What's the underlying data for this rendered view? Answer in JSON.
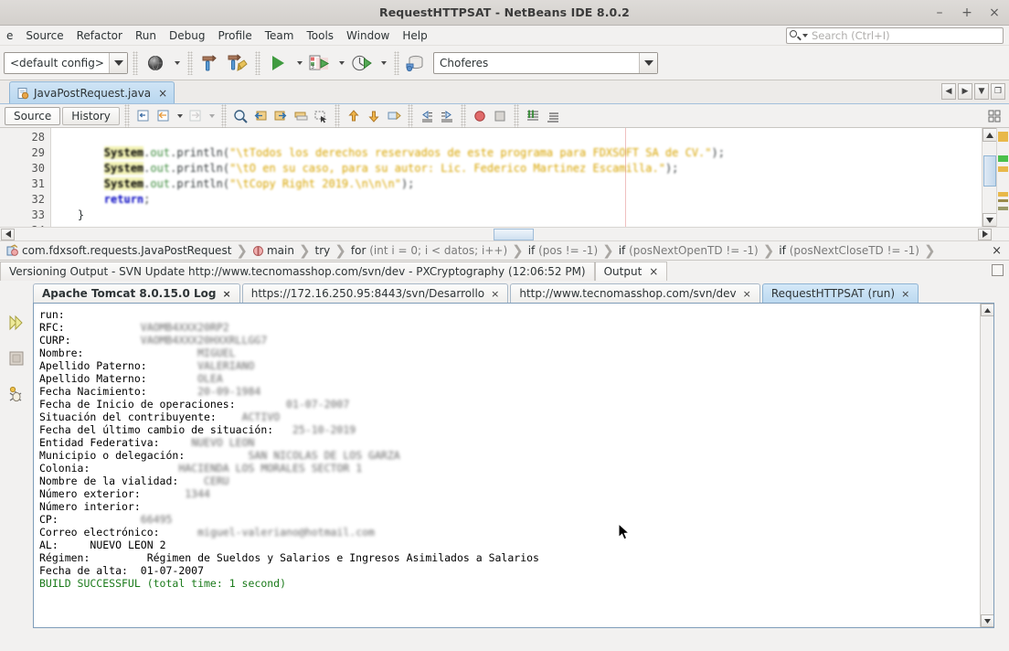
{
  "window": {
    "title": "RequestHTTPSAT - NetBeans IDE 8.0.2",
    "minimize": "–",
    "maximize": "+",
    "close": "×"
  },
  "menu": {
    "items": [
      {
        "label": "e"
      },
      {
        "label": "Source"
      },
      {
        "label": "Refactor"
      },
      {
        "label": "Run"
      },
      {
        "label": "Debug"
      },
      {
        "label": "Profile"
      },
      {
        "label": "Team"
      },
      {
        "label": "Tools"
      },
      {
        "label": "Window"
      },
      {
        "label": "Help"
      }
    ],
    "search_placeholder": "Search (Ctrl+I)"
  },
  "toolbar": {
    "config_value": "<default config>",
    "project_value": "Choferes",
    "icons": [
      "globe-icon",
      "build-icon",
      "clean-build-icon",
      "run-project-icon",
      "debug-project-icon",
      "profile-project-icon",
      "database-connection-icon"
    ]
  },
  "editor_tabs": {
    "tabs": [
      {
        "label": "JavaPostRequest.java",
        "close": "×",
        "selected": true
      }
    ],
    "nav": [
      "◀",
      "▶",
      "▼",
      "❐"
    ]
  },
  "editor_toolbar": {
    "source_label": "Source",
    "history_label": "History",
    "icons": [
      "last-edit-icon",
      "back-icon",
      "forward-icon",
      "find-selection-icon",
      "find-previous-icon",
      "find-next-icon",
      "toggle-highlight-icon",
      "rectangular-selection-icon",
      "previous-bookmark-icon",
      "next-bookmark-icon",
      "toggle-bookmark-icon",
      "shift-left-icon",
      "shift-right-icon",
      "toggle-breakpoint-icon",
      "stop-icon",
      "comment-icon",
      "uncomment-icon"
    ]
  },
  "code": {
    "lines": [
      {
        "num": "28",
        "segments": []
      },
      {
        "num": "29",
        "indent": "        ",
        "sys": "System",
        "dot1": ".",
        "field": "out",
        "dot2": ".",
        "method": "println(",
        "string": "\"\\tTodos los derechos reservados de este programa para FDXSOFT SA de CV.\"",
        "tail": ");"
      },
      {
        "num": "30",
        "indent": "        ",
        "sys": "System",
        "dot1": ".",
        "field": "out",
        "dot2": ".",
        "method": "println(",
        "string": "\"\\tO en su caso, para su autor: Lic. Federico Martinez Escamilla.\"",
        "tail": ");"
      },
      {
        "num": "31",
        "indent": "        ",
        "sys": "System",
        "dot1": ".",
        "field": "out",
        "dot2": ".",
        "method": "println(",
        "string": "\"\\tCopy Right 2019.\\n\\n\\n\"",
        "tail": ");"
      },
      {
        "num": "32",
        "indent": "        ",
        "keyword": "return",
        "tail": ";"
      },
      {
        "num": "33",
        "indent": "    ",
        "tail": "}"
      },
      {
        "num": "34",
        "segments": []
      }
    ]
  },
  "breadcrumb": {
    "items": [
      {
        "label": "com.fdxsoft.requests.JavaPostRequest",
        "icon": "class-icon"
      },
      {
        "label": "main",
        "icon": "method-icon"
      },
      {
        "label": "try"
      },
      {
        "label": "for",
        "detail": "(int i = 0; i < datos; i++)"
      },
      {
        "label": "if",
        "detail": "(pos != -1)"
      },
      {
        "label": "if",
        "detail": "(posNextOpenTD != -1)"
      },
      {
        "label": "if",
        "detail": "(posNextCloseTD != -1)"
      }
    ],
    "separator": "❯",
    "close": "×"
  },
  "window_tabs": {
    "tabs": [
      {
        "label": "Versioning Output - SVN Update http://www.tecnomasshop.com/svn/dev - PXCryptography (12:06:52 PM)",
        "selected": false
      },
      {
        "label": "Output",
        "selected": true,
        "close": "×"
      }
    ]
  },
  "output": {
    "tabs": [
      {
        "label": "Apache Tomcat 8.0.15.0 Log",
        "close": "×",
        "selected": false,
        "bold": true
      },
      {
        "label": "https://172.16.250.95:8443/svn/Desarrollo",
        "close": "×",
        "selected": false
      },
      {
        "label": "http://www.tecnomasshop.com/svn/dev",
        "close": "×",
        "selected": false
      },
      {
        "label": "RequestHTTPSAT (run)",
        "close": "×",
        "selected": true
      }
    ],
    "side_icons": [
      "rerun-icon",
      "stop-icon",
      "debug-icon"
    ],
    "lines": [
      {
        "text": "run:",
        "style": "plain"
      },
      {
        "label": "RFC:",
        "pad": 12,
        "value": "VAOMB4XXX20RP2",
        "redacted": true
      },
      {
        "label": "CURP:",
        "pad": 11,
        "value": "VAOMB4XXX20HXXRLLGG7",
        "redacted": true
      },
      {
        "label": "Nombre:",
        "pad": 18,
        "value": "MIGUEL",
        "redacted": true
      },
      {
        "label": "Apellido Paterno:",
        "pad": 8,
        "value": "VALERIANO",
        "redacted": true
      },
      {
        "label": "Apellido Materno:",
        "pad": 8,
        "value": "OLEA",
        "redacted": true
      },
      {
        "label": "Fecha Nacimiento:",
        "pad": 8,
        "value": "20-09-1984",
        "redacted": true
      },
      {
        "label": "Fecha de Inicio de operaciones:",
        "pad": 8,
        "value": "01-07-2007",
        "redacted": true
      },
      {
        "label": "Situación del contribuyente:",
        "pad": 4,
        "value": "ACTIVO",
        "redacted": true
      },
      {
        "label": "Fecha del último cambio de situación:",
        "pad": 3,
        "value": "25-10-2019",
        "redacted": true
      },
      {
        "label": "Entidad Federativa:",
        "pad": 5,
        "value": "NUEVO LEON",
        "redacted": true
      },
      {
        "label": "Municipio o delegación:",
        "pad": 10,
        "value": "SAN NICOLAS DE LOS GARZA",
        "redacted": true
      },
      {
        "label": "Colonia:",
        "pad": 14,
        "value": "HACIENDA LOS MORALES SECTOR 1",
        "redacted": true
      },
      {
        "label": "Nombre de la vialidad:",
        "pad": 4,
        "value": "CERU",
        "redacted": true
      },
      {
        "label": "Número exterior:",
        "pad": 7,
        "value": "1344",
        "redacted": true
      },
      {
        "label": "Número interior:",
        "pad": 0,
        "value": "",
        "redacted": true
      },
      {
        "label": "CP:",
        "pad": 13,
        "value": "66495",
        "redacted": true
      },
      {
        "label": "Correo electrónico:",
        "pad": 6,
        "value": "miguel-valeriano@hotmail.com",
        "redacted": true
      },
      {
        "label": "AL:",
        "pad": 5,
        "value": "NUEVO LEON 2",
        "redacted": false
      },
      {
        "label": "Régimen:",
        "pad": 9,
        "value": "Régimen de Sueldos y Salarios e Ingresos Asimilados a Salarios",
        "redacted": false
      },
      {
        "label": "Fecha de alta:",
        "pad": 2,
        "value": "01-07-2007",
        "redacted": false
      },
      {
        "text": "BUILD SUCCESSFUL (total time: 1 second)",
        "style": "green"
      }
    ]
  },
  "colors": {
    "accent_blue": "#bcd9f0",
    "build_success_green": "#1a7a1a",
    "keyword_blue": "#0000c0",
    "string_gold": "#d8a400",
    "field_green": "#3b8a3b"
  }
}
